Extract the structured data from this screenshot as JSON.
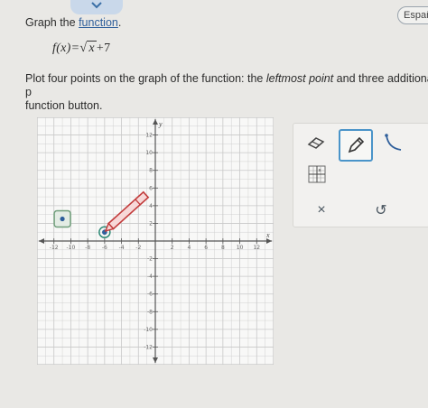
{
  "top_tab": {
    "icon": "chevron-down-icon"
  },
  "language_button": {
    "label": "Españo"
  },
  "intro": {
    "prefix": "Graph the ",
    "link": "function",
    "suffix": "."
  },
  "formula": {
    "lhs": "f(x)=",
    "radicand": "x",
    "rhs": "+7"
  },
  "instructions": {
    "part1": "Plot four points on the graph of the function: the ",
    "emphasis": "leftmost point",
    "part2": " and three additional p",
    "line2": "function button."
  },
  "graph": {
    "x_axis_label": "x",
    "y_axis_label": "y",
    "x_range": [
      -14,
      14
    ],
    "y_range": [
      -14,
      14
    ],
    "x_ticks": [
      "-12",
      "-10",
      "-8",
      "-6",
      "-4",
      "-2",
      "2",
      "4",
      "6",
      "8",
      "10",
      "12"
    ],
    "y_ticks": [
      "12",
      "10",
      "8",
      "6",
      "4",
      "2",
      "-2",
      "-4",
      "-6",
      "-8",
      "-10",
      "-12"
    ],
    "plotted_point": {
      "x": -6,
      "y": 1
    },
    "colors": {
      "grid": "#c8c8c8",
      "axis": "#555555",
      "point": "#2e8a76"
    }
  },
  "tools": {
    "point_tool": "point-tool-icon",
    "eraser": "eraser-icon",
    "pencil": "pencil-icon",
    "curve": "curve-tool-icon",
    "grid_toggle": "grid-icon",
    "clear": "×",
    "undo": "↺"
  }
}
